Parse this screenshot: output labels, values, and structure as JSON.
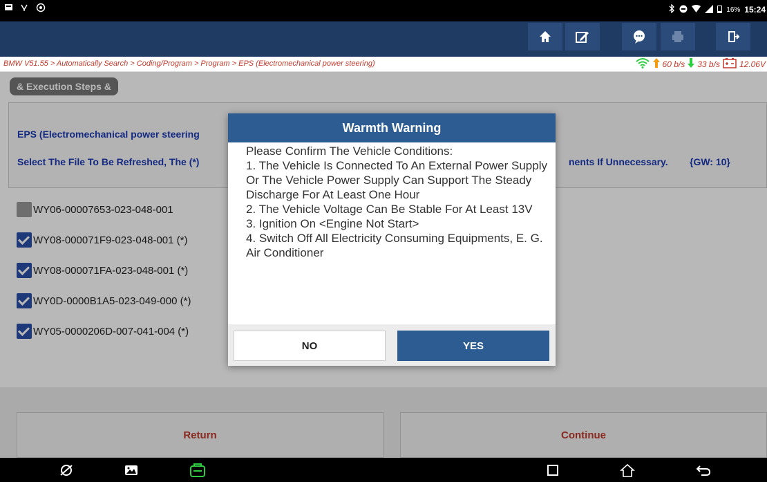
{
  "status_bar": {
    "battery": "16%",
    "time": "15:24"
  },
  "breadcrumb": "BMW V51.55 > Automatically Search > Coding/Program > Program > EPS (Electromechanical power steering)",
  "net_stats": {
    "upload": "60 b/s",
    "download": "33 b/s",
    "voltage": "12.06V"
  },
  "steps_button": "& Execution Steps &",
  "info": {
    "title": "EPS (Electromechanical power steering",
    "instruction": "Select The File To Be Refreshed, The (*)",
    "instruction_tail": "nents If Unnecessary.",
    "gw": "{GW: 10}"
  },
  "files": [
    {
      "label": "WY06-00007653-023-048-001",
      "checked": false
    },
    {
      "label": "WY08-000071F9-023-048-001  (*)",
      "checked": true
    },
    {
      "label": "WY08-000071FA-023-048-001  (*)",
      "checked": true
    },
    {
      "label": "WY0D-0000B1A5-023-049-000  (*)",
      "checked": true
    },
    {
      "label": "WY05-0000206D-007-041-004  (*)",
      "checked": true
    }
  ],
  "buttons": {
    "return": "Return",
    "continue": "Continue"
  },
  "dialog": {
    "title": "Warmth Warning",
    "lines": [
      "Please Confirm The Vehicle Conditions:",
      "1. The Vehicle Is Connected To An External Power Supply Or The Vehicle Power Supply Can Support The Steady Discharge For At Least One Hour",
      "2. The Vehicle Voltage Can Be Stable For At Least 13V",
      "3. Ignition On <Engine Not Start>",
      "4. Switch Off All Electricity Consuming Equipments, E. G. Air Conditioner"
    ],
    "no_label": "NO",
    "yes_label": "YES"
  },
  "colors": {
    "toolbar": "#1f3b63",
    "dialog_header": "#2c5c92",
    "accent_red": "#c0392b",
    "info_blue": "#1d3bb5"
  },
  "icons": {
    "toolbar": [
      "home-icon",
      "edit-icon",
      "chat-icon",
      "print-icon",
      "exit-icon"
    ],
    "nav": [
      "browser-icon",
      "gallery-icon",
      "vci-icon",
      "recents-icon",
      "home-icon",
      "back-icon"
    ]
  }
}
